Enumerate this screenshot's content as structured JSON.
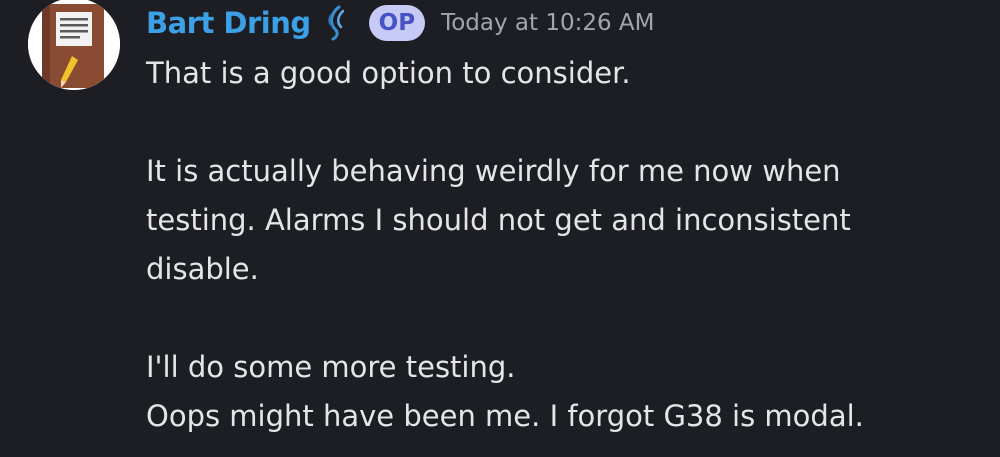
{
  "message": {
    "author": "Bart Dring",
    "role_icon": "role-leaf-icon",
    "badge": "OP",
    "timestamp": "Today at 10:26 AM",
    "avatar_icon": "notebook-pencil-icon",
    "lines": [
      "That is a good option to consider.",
      "",
      "It is actually behaving weirdly for me now when",
      "testing. Alarms I should not get and inconsistent",
      "disable.",
      "",
      "I'll do some more testing.",
      "Oops might have been me. I forgot G38 is modal."
    ]
  },
  "colors": {
    "background": "#1d1e23",
    "username": "#3ba0e6",
    "badge_bg": "#c7caf5",
    "badge_text": "#4752c4",
    "timestamp": "#a2a5ab",
    "text": "#e3e5e8"
  }
}
